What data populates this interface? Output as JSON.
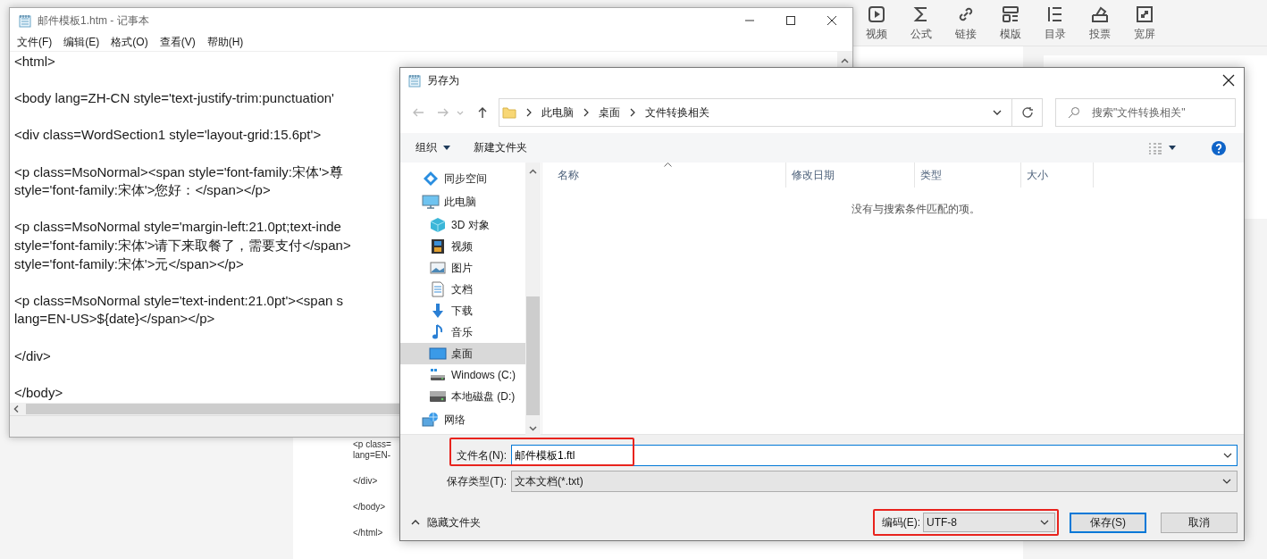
{
  "background_page": {
    "toolbar": [
      {
        "label": "视频"
      },
      {
        "label": "公式"
      },
      {
        "label": "链接"
      },
      {
        "label": "模版"
      },
      {
        "label": "目录"
      },
      {
        "label": "投票"
      },
      {
        "label": "宽屏"
      }
    ],
    "document_lines": [
      "<p class=",
      "lang=EN-",
      "</div>",
      "</body>",
      "</html>"
    ]
  },
  "notepad": {
    "title": "邮件模板1.htm - 记事本",
    "menu": [
      "文件(F)",
      "编辑(E)",
      "格式(O)",
      "查看(V)",
      "帮助(H)"
    ],
    "paragraphs": [
      [
        "<html>"
      ],
      [
        "<body lang=ZH-CN style='text-justify-trim:punctuation'"
      ],
      [
        "<div class=WordSection1 style='layout-grid:15.6pt'>"
      ],
      [
        "<p class=MsoNormal><span style='font-family:宋体'>尊",
        "style='font-family:宋体'>您好：</span></p>"
      ],
      [
        "<p class=MsoNormal style='margin-left:21.0pt;text-inde",
        "style='font-family:宋体'>请下来取餐了，需要支付</span>",
        "style='font-family:宋体'>元</span></p>"
      ],
      [
        "<p class=MsoNormal style='text-indent:21.0pt'><span s",
        "lang=EN-US>${date}</span></p>"
      ],
      [
        "</div>"
      ],
      [
        "</body>"
      ]
    ]
  },
  "save_dialog": {
    "title": "另存为",
    "breadcrumb": [
      "此电脑",
      "桌面",
      "文件转换相关"
    ],
    "search": {
      "placeholder": "搜索\"文件转换相关\""
    },
    "toolbar": {
      "organize": "组织",
      "new_folder": "新建文件夹"
    },
    "sidebar": {
      "items": [
        {
          "label": "同步空间",
          "selected": false
        },
        {
          "label": "此电脑",
          "selected": false,
          "children": [
            {
              "label": "3D 对象",
              "selected": false
            },
            {
              "label": "视频",
              "selected": false
            },
            {
              "label": "图片",
              "selected": false
            },
            {
              "label": "文档",
              "selected": false
            },
            {
              "label": "下载",
              "selected": false
            },
            {
              "label": "音乐",
              "selected": false
            },
            {
              "label": "桌面",
              "selected": true
            },
            {
              "label": "Windows (C:)",
              "selected": false
            },
            {
              "label": "本地磁盘 (D:)",
              "selected": false
            }
          ]
        },
        {
          "label": "网络",
          "selected": false
        }
      ]
    },
    "columns": [
      "名称",
      "修改日期",
      "类型",
      "大小"
    ],
    "empty_message": "没有与搜索条件匹配的项。",
    "file_name": {
      "label": "文件名(N):",
      "value": "邮件模板1.ftl",
      "highlighted": true
    },
    "file_type": {
      "label": "保存类型(T):",
      "value": "文本文档(*.txt)"
    },
    "hide_folders": "隐藏文件夹",
    "encoding": {
      "label": "编码(E):",
      "value": "UTF-8",
      "highlighted": true
    },
    "buttons": [
      {
        "label": "保存(S)",
        "default": true
      },
      {
        "label": "取消",
        "default": false
      }
    ]
  }
}
